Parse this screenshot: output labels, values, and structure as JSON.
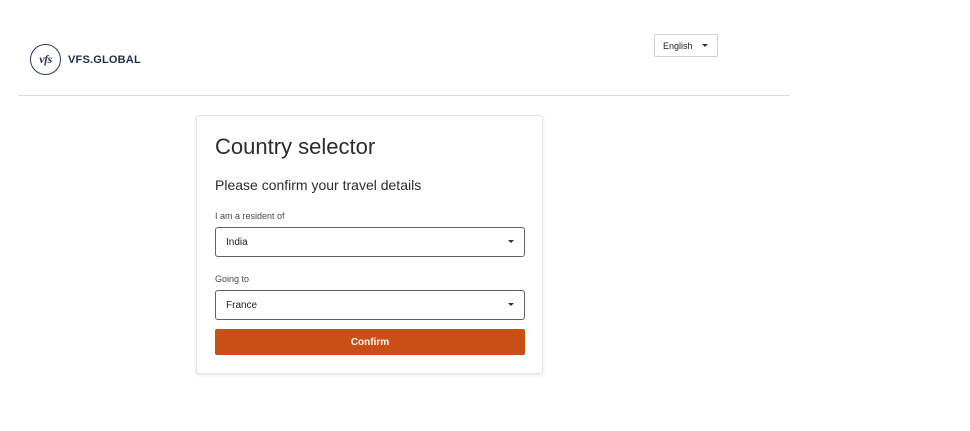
{
  "header": {
    "logo_mark": "vfs",
    "brand": "VFS.GLOBAL",
    "language": "English",
    "language_icon": "chevron-down-icon"
  },
  "card": {
    "title": "Country selector",
    "subtitle": "Please confirm your travel details",
    "resident": {
      "label": "I am a resident of",
      "value": "India"
    },
    "destination": {
      "label": "Going to",
      "value": "France"
    },
    "confirm_label": "Confirm"
  },
  "colors": {
    "accent": "#c94f16",
    "brand": "#24304d"
  }
}
